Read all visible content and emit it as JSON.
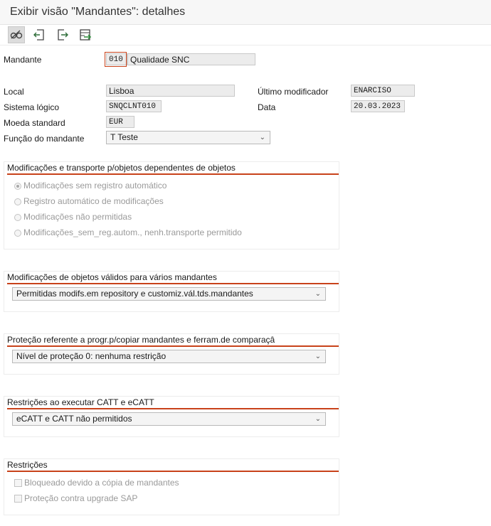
{
  "window": {
    "title": "Exibir visão \"Mandantes\": detalhes"
  },
  "toolbar": {
    "buttons": [
      {
        "icon": "glasses-display-change-icon"
      },
      {
        "icon": "previous-entry-icon"
      },
      {
        "icon": "next-entry-icon"
      },
      {
        "icon": "transport-icon"
      }
    ]
  },
  "fields": {
    "mandante_label": "Mandante",
    "mandante_value": "010",
    "mandante_desc": "Qualidade SNC",
    "local_label": "Local",
    "local_value": "Lisboa",
    "sistema_label": "Sistema lógico",
    "sistema_value": "SNQCLNT010",
    "moeda_label": "Moeda standard",
    "moeda_value": "EUR",
    "funcao_label": "Função do mandante",
    "funcao_value": "T Teste",
    "modificador_label": "Último modificador",
    "modificador_value": "ENARCISO",
    "data_label": "Data",
    "data_value": "20.03.2023"
  },
  "groups": {
    "g1": {
      "title": "Modificações e transporte p/objetos dependentes de objetos",
      "options": [
        {
          "label": "Modificações sem registro automático",
          "selected": true
        },
        {
          "label": "Registro automático de modificações",
          "selected": false
        },
        {
          "label": "Modificações não permitidas",
          "selected": false
        },
        {
          "label": "Modificações_sem_reg.autom., nenh.transporte permitido",
          "selected": false
        }
      ]
    },
    "g2": {
      "title": "Modificações de objetos válidos para vários mandantes",
      "select": "Permitidas modifs.em repository e customiz.vál.tds.mandantes"
    },
    "g3": {
      "title": "Proteção referente a progr.p/copiar mandantes e ferram.de comparaçâ",
      "select": "Nível de proteção 0: nenhuma restrição"
    },
    "g4": {
      "title": "Restrições ao executar CATT e eCATT",
      "select": "eCATT e CATT não permitidos"
    },
    "g5": {
      "title": "Restrições",
      "checks": [
        {
          "label": "Bloqueado devido a cópia de mandantes",
          "checked": false
        },
        {
          "label": "Proteção contra upgrade SAP",
          "checked": false
        }
      ]
    }
  },
  "colors": {
    "accent": "#c8421a",
    "readonly_bg": "#ececec",
    "disabled_text": "#9a9a9a"
  }
}
